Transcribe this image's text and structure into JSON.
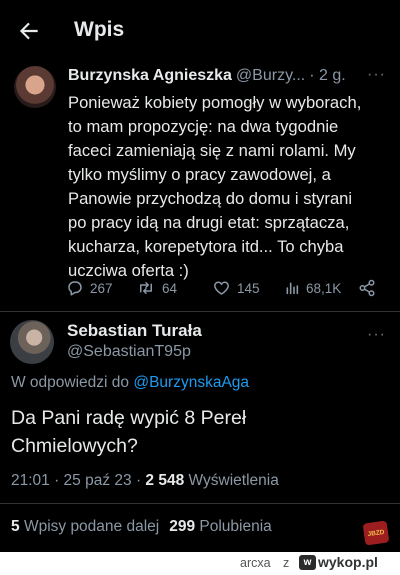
{
  "header": {
    "title": "Wpis"
  },
  "quoted_tweet": {
    "author_name": "Burzynska Agnieszka",
    "author_handle": "@Burzy...",
    "time": "· 2 g.",
    "more": "···",
    "lines": [
      "Ponieważ kobiety pomogły w wyborach,",
      "to mam propozycję: na dwa tygodnie",
      "faceci zamieniają się z nami rolami. My",
      "tylko myślimy o pracy zawodowej, a",
      "Panowie przychodzą do domu i styrani",
      "po pracy idą na drugi etat: sprzątacza,",
      "kucharza, korepetytora itd... To chyba",
      "uczciwa oferta :)"
    ],
    "actions": {
      "replies": "267",
      "retweets": "64",
      "likes": "145",
      "views": "68,1K"
    }
  },
  "main_tweet": {
    "author_name": "Sebastian Turała",
    "author_handle": "@SebastianT95p",
    "more": "···",
    "reply_prefix": "W odpowiedzi do",
    "reply_handle": "@BurzynskaAga",
    "text_line1": "Da Pani radę wypić 8 Pereł",
    "text_line2": "Chmielowych?",
    "meta_time": "21:01 · 25 paź 23 · ",
    "meta_views_count": "2 548",
    "meta_views_label": "Wyświetlenia",
    "retweets_count": "5",
    "retweets_label": "Wpisy podane dalej",
    "likes_count": "299",
    "likes_label": "Polubienia"
  },
  "badge": {
    "text": "JBZD"
  },
  "footer": {
    "user": "arcxa",
    "connector": "z",
    "logo_glyph": "w",
    "site": "wykop.pl"
  },
  "colors": {
    "background": "#000000",
    "text": "#e7e9ea",
    "muted": "#8b98a5",
    "link": "#1d9bf0",
    "divider": "#2f3336"
  }
}
